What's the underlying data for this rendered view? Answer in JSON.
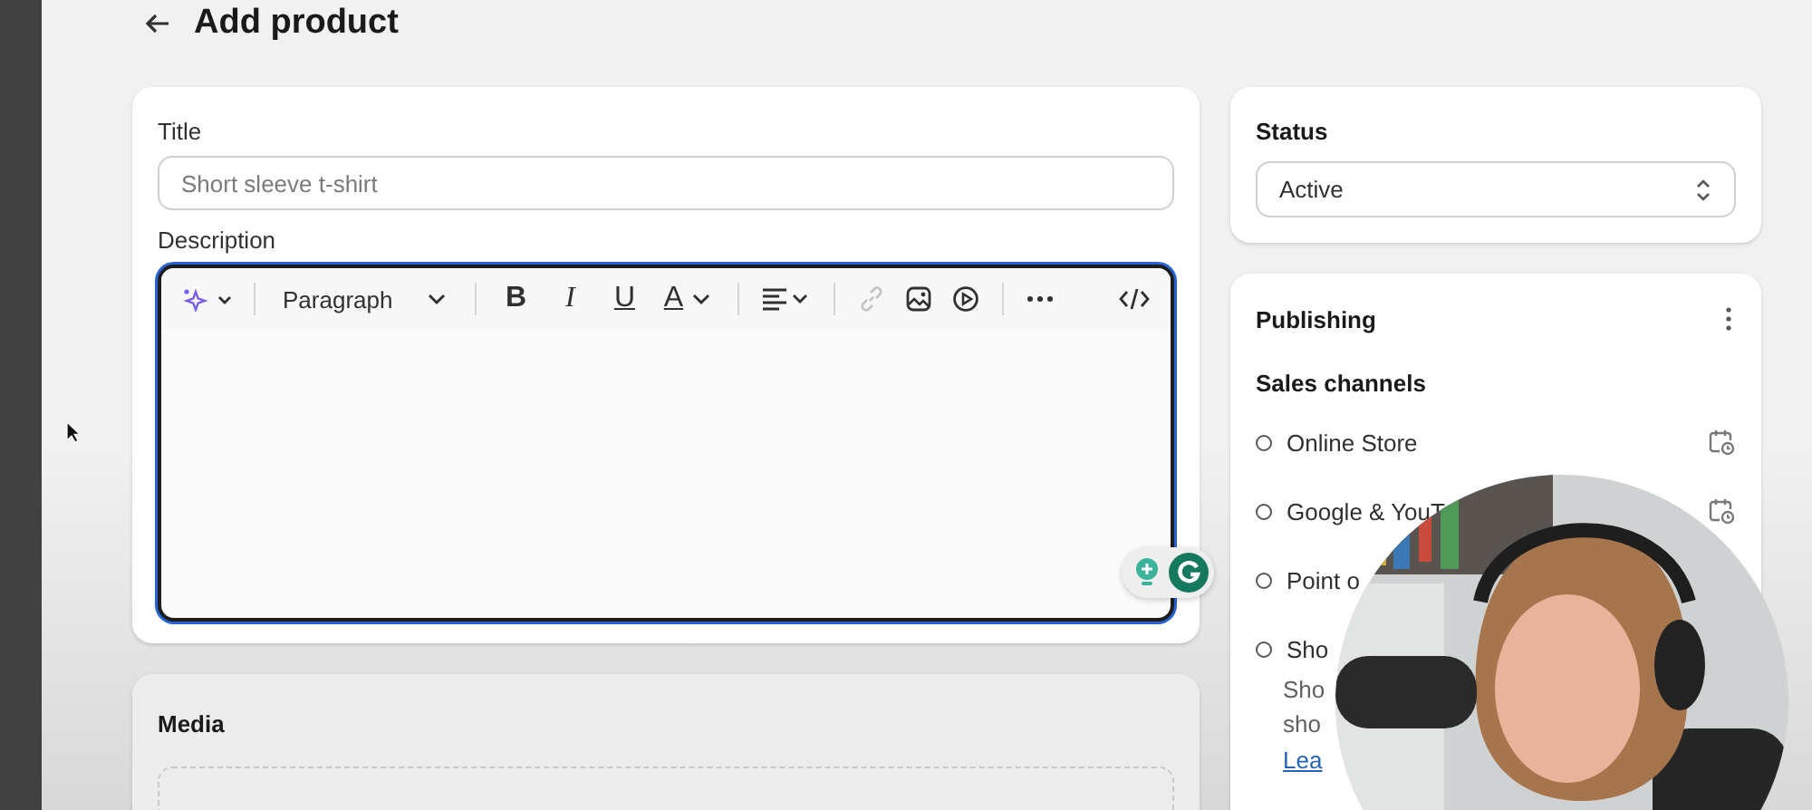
{
  "page": {
    "title": "Add product"
  },
  "product_card": {
    "title_label": "Title",
    "title_field": {
      "placeholder": "Short sleeve t-shirt"
    },
    "description_label": "Description",
    "editor": {
      "focused": true,
      "toolbar": {
        "format": "Paragraph",
        "bold": "B",
        "italic": "I",
        "underline": "U",
        "text_color_glyph": "A",
        "link_disabled": true
      }
    }
  },
  "media_card": {
    "title": "Media"
  },
  "status_card": {
    "label": "Status",
    "value": "Active"
  },
  "publishing_card": {
    "title": "Publishing",
    "section": "Sales channels",
    "channels": [
      {
        "name": "Online Store",
        "selected": false,
        "schedule_icon": true
      },
      {
        "name": "Google & YouT",
        "selected": false,
        "schedule_icon": true
      },
      {
        "name": "Point o",
        "selected": false,
        "schedule_icon": false
      },
      {
        "name": "Sho",
        "selected": false,
        "schedule_icon": false,
        "description_lines": [
          "Sho",
          "sho"
        ],
        "link": "Lea"
      }
    ]
  }
}
